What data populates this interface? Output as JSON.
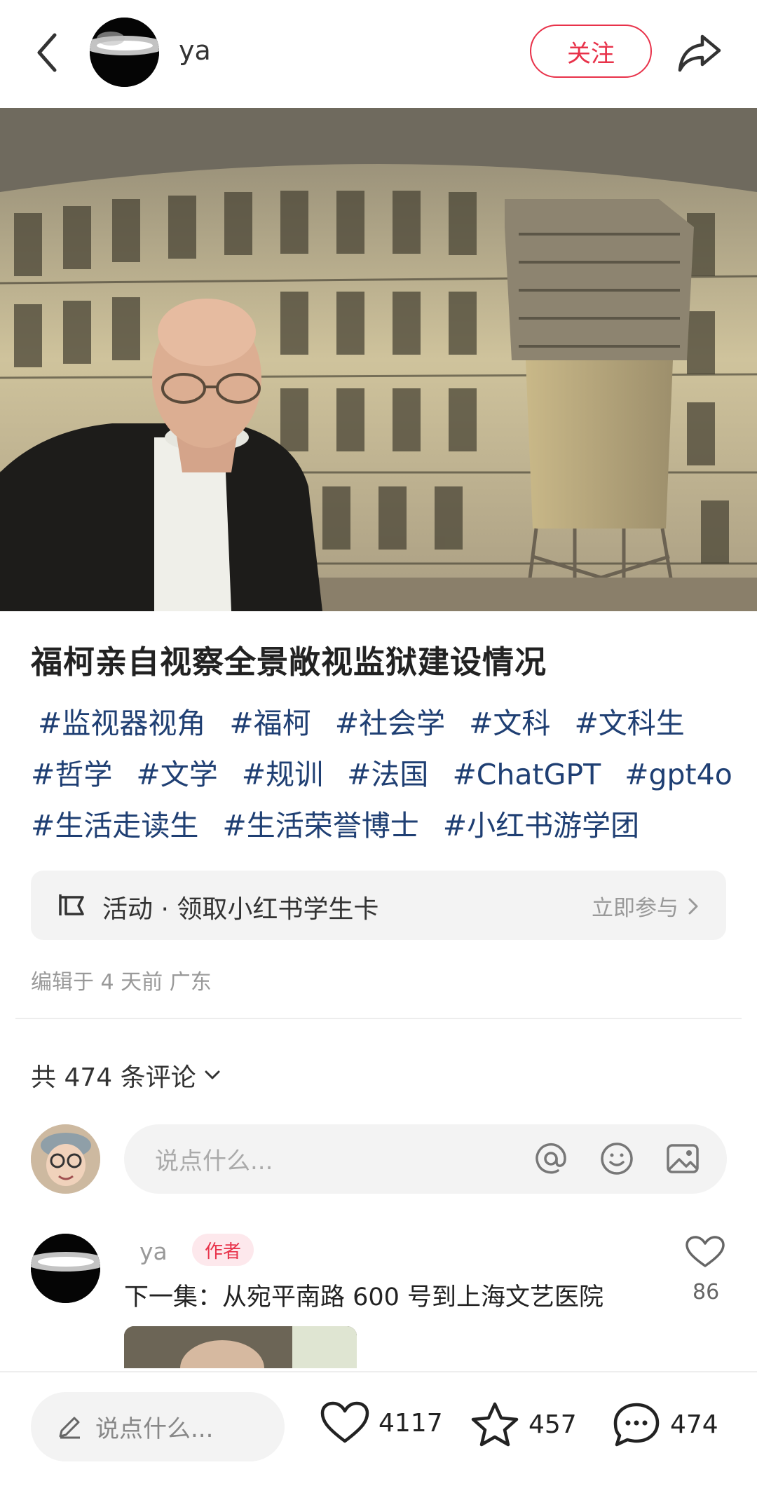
{
  "header": {
    "username": "ya",
    "follow_label": "关注"
  },
  "post": {
    "title": "福柯亲自视察全景敞视监狱建设情况",
    "tags": [
      "#监视器视角",
      "#福柯",
      "#社会学",
      "#文科",
      "#文科生",
      "#哲学",
      "#文学",
      "#规训",
      "#法国",
      "#ChatGPT",
      "#gpt4o",
      "#生活走读生",
      "#生活荣誉博士",
      "#小红书游学团"
    ],
    "activity_text": "活动 · 领取小红书学生卡",
    "activity_cta": "立即参与",
    "edited": "编辑于 4 天前 广东"
  },
  "comments": {
    "count_label": "共 474 条评论",
    "input_placeholder": "说点什么...",
    "items": [
      {
        "name": "ya",
        "badge": "作者",
        "text": "下一集：从宛平南路 600 号到上海文艺医院",
        "likes": "86"
      }
    ]
  },
  "bottom_bar": {
    "input_placeholder": "说点什么...",
    "likes": "4117",
    "favorites": "457",
    "comments": "474"
  },
  "icons": [
    "back-icon",
    "share-icon",
    "activity-icon",
    "chevron-right-icon",
    "chevron-down-icon",
    "at-icon",
    "emoji-icon",
    "image-icon",
    "heart-icon",
    "star-icon",
    "comment-icon",
    "pencil-icon"
  ],
  "colors": {
    "accent": "#e8324a",
    "tag": "#1f3f73"
  }
}
